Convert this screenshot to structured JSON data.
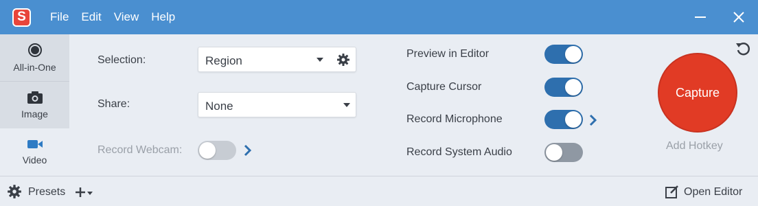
{
  "app": {
    "logo_letter": "S",
    "menu": [
      "File",
      "Edit",
      "View",
      "Help"
    ]
  },
  "nav": {
    "items": [
      {
        "label": "All-in-One",
        "icon": "record-circle-icon",
        "active": false
      },
      {
        "label": "Image",
        "icon": "camera-icon",
        "active": false
      },
      {
        "label": "Video",
        "icon": "video-camera-icon",
        "active": true
      }
    ]
  },
  "settings": {
    "selection_label": "Selection:",
    "selection_value": "Region",
    "share_label": "Share:",
    "share_value": "None",
    "webcam_label": "Record Webcam:",
    "webcam_enabled": false
  },
  "toggles": [
    {
      "label": "Preview in Editor",
      "on": true,
      "has_more": false
    },
    {
      "label": "Capture Cursor",
      "on": true,
      "has_more": false
    },
    {
      "label": "Record Microphone",
      "on": true,
      "has_more": true
    },
    {
      "label": "Record System Audio",
      "on": false,
      "has_more": false
    }
  ],
  "capture": {
    "button_label": "Capture",
    "hotkey_label": "Add Hotkey"
  },
  "bottom": {
    "presets_label": "Presets",
    "open_editor_label": "Open Editor"
  },
  "colors": {
    "titlebar": "#4a8fd0",
    "toggle_on": "#2e6fae",
    "capture": "#e13b25",
    "active_icon": "#2e7bc4"
  }
}
